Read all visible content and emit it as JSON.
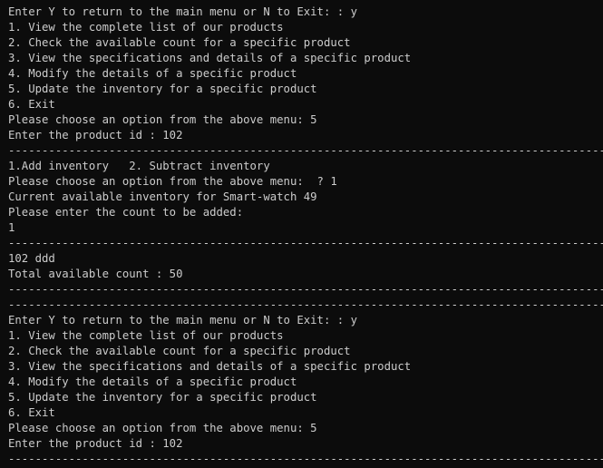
{
  "terminal": {
    "lines": [
      "Enter Y to return to the main menu or N to Exit: : y",
      "1. View the complete list of our products",
      "2. Check the available count for a specific product",
      "3. View the specifications and details of a specific product",
      "4. Modify the details of a specific product",
      "5. Update the inventory for a specific product",
      "6. Exit",
      "Please choose an option from the above menu: 5",
      "Enter the product id : 102",
      "------------------------------------------------------------------------------------------",
      "1.Add inventory   2. Subtract inventory",
      "Please choose an option from the above menu:  ? 1",
      "Current available inventory for Smart-watch 49",
      "Please enter the count to be added:",
      "1",
      "------------------------------------------------------------------------------------------",
      "102 ddd",
      "Total available count : 50",
      "------------------------------------------------------------------------------------------",
      "------------------------------------------------------------------------------------------",
      "Enter Y to return to the main menu or N to Exit: : y",
      "1. View the complete list of our products",
      "2. Check the available count for a specific product",
      "3. View the specifications and details of a specific product",
      "4. Modify the details of a specific product",
      "5. Update the inventory for a specific product",
      "6. Exit",
      "Please choose an option from the above menu: 5",
      "Enter the product id : 102",
      "------------------------------------------------------------------------------------------"
    ]
  }
}
